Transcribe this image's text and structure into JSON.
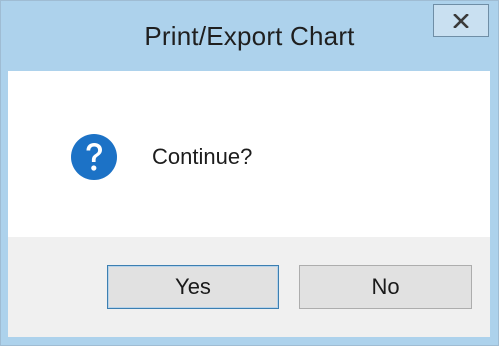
{
  "window": {
    "title": "Print/Export Chart",
    "close_label": "x",
    "close_icon": "close-icon"
  },
  "dialog": {
    "icon": "question-icon",
    "message": "Continue?"
  },
  "buttons": {
    "yes_label": "Yes",
    "no_label": "No"
  },
  "colors": {
    "titlebar": "#add2ec",
    "question_icon": "#1c72c6",
    "footer": "#f0f0f0",
    "button": "#e1e1e1",
    "default_button_border": "#3c7fb1"
  }
}
